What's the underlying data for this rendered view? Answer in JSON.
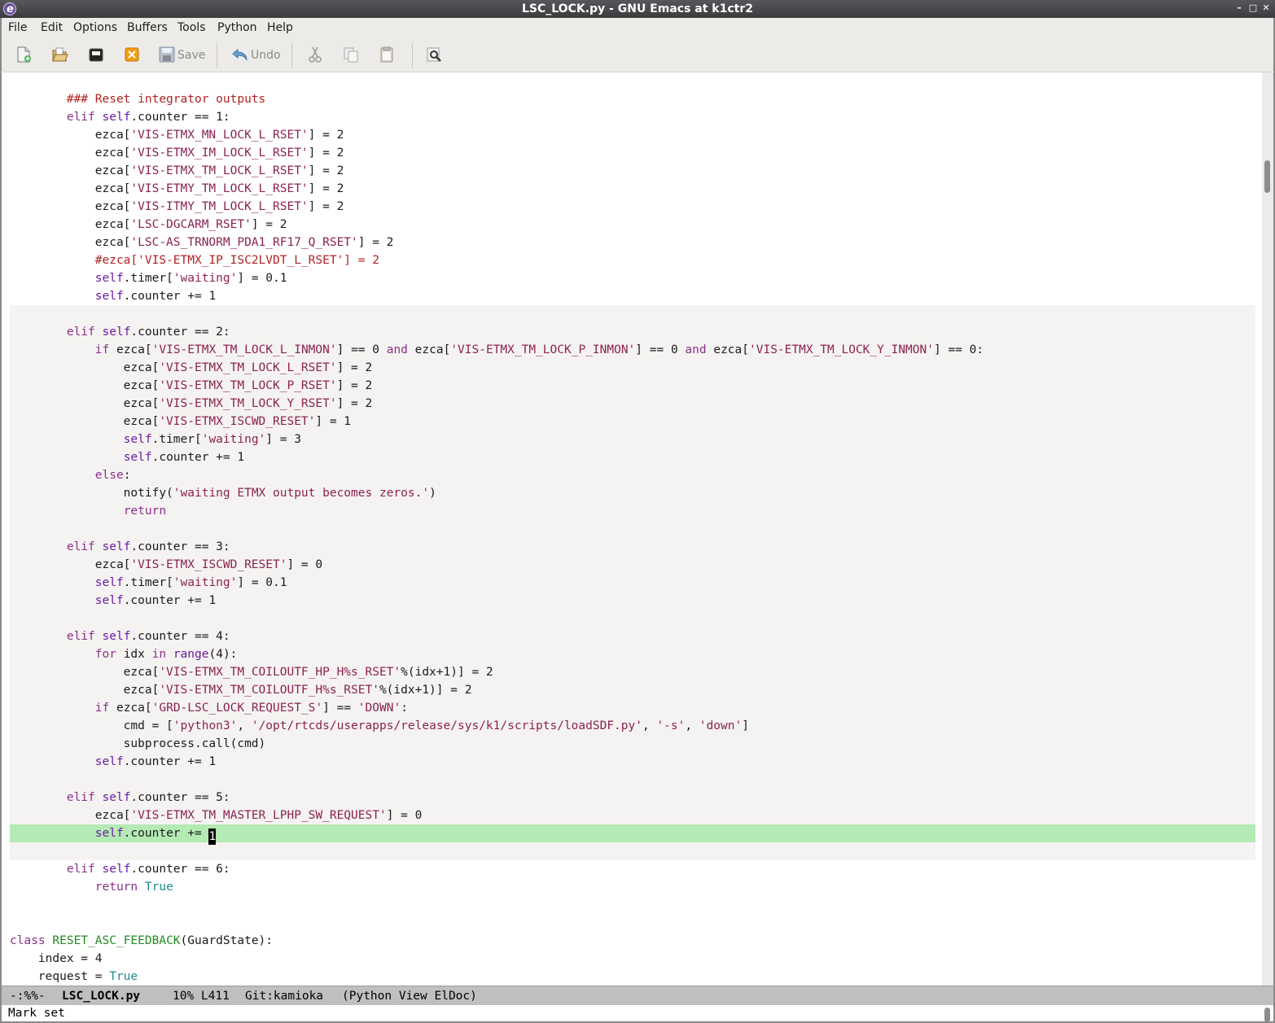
{
  "window": {
    "title": "LSC_LOCK.py - GNU Emacs at k1ctr2"
  },
  "menu": [
    "File",
    "Edit",
    "Options",
    "Buffers",
    "Tools",
    "Python",
    "Help"
  ],
  "toolbar": {
    "save_label": "Save",
    "undo_label": "Undo",
    "icons": [
      "new-file-icon",
      "open-file-icon",
      "dired-icon",
      "close-buffer-icon",
      "save-icon",
      "undo-icon",
      "cut-icon",
      "copy-icon",
      "paste-icon",
      "search-icon"
    ]
  },
  "code": {
    "lines": [
      "",
      [
        [
          "",
          "        "
        ],
        [
          "cm",
          "### Reset integrator outputs"
        ]
      ],
      [
        [
          "",
          "        "
        ],
        [
          "kw",
          "elif"
        ],
        [
          "",
          " "
        ],
        [
          "bi",
          "self"
        ],
        [
          "",
          ".counter == 1:"
        ]
      ],
      [
        [
          "",
          "            ezca["
        ],
        [
          "st",
          "'VIS-ETMX_MN_LOCK_L_RSET'"
        ],
        [
          "",
          "] = 2"
        ]
      ],
      [
        [
          "",
          "            ezca["
        ],
        [
          "st",
          "'VIS-ETMX_IM_LOCK_L_RSET'"
        ],
        [
          "",
          "] = 2"
        ]
      ],
      [
        [
          "",
          "            ezca["
        ],
        [
          "st",
          "'VIS-ETMX_TM_LOCK_L_RSET'"
        ],
        [
          "",
          "] = 2"
        ]
      ],
      [
        [
          "",
          "            ezca["
        ],
        [
          "st",
          "'VIS-ETMY_TM_LOCK_L_RSET'"
        ],
        [
          "",
          "] = 2"
        ]
      ],
      [
        [
          "",
          "            ezca["
        ],
        [
          "st",
          "'VIS-ITMY_TM_LOCK_L_RSET'"
        ],
        [
          "",
          "] = 2"
        ]
      ],
      [
        [
          "",
          "            ezca["
        ],
        [
          "st",
          "'LSC-DGCARM_RSET'"
        ],
        [
          "",
          "] = 2"
        ]
      ],
      [
        [
          "",
          "            ezca["
        ],
        [
          "st",
          "'LSC-AS_TRNORM_PDA1_RF17_Q_RSET'"
        ],
        [
          "",
          "] = 2"
        ]
      ],
      [
        [
          "",
          "            "
        ],
        [
          "cm",
          "#ezca['VIS-ETMX_IP_ISC2LVDT_L_RSET'] = 2"
        ]
      ],
      [
        [
          "",
          "            "
        ],
        [
          "bi",
          "self"
        ],
        [
          "",
          ".timer["
        ],
        [
          "st",
          "'waiting'"
        ],
        [
          "",
          "] = 0.1"
        ]
      ],
      [
        [
          "",
          "            "
        ],
        [
          "bi",
          "self"
        ],
        [
          "",
          ".counter += 1"
        ]
      ],
      "",
      [
        [
          "",
          "        "
        ],
        [
          "kw",
          "elif"
        ],
        [
          "",
          " "
        ],
        [
          "bi",
          "self"
        ],
        [
          "",
          ".counter == 2:"
        ]
      ],
      [
        [
          "",
          "            "
        ],
        [
          "kw",
          "if"
        ],
        [
          "",
          " ezca["
        ],
        [
          "st",
          "'VIS-ETMX_TM_LOCK_L_INMON'"
        ],
        [
          "",
          "] == 0 "
        ],
        [
          "kw",
          "and"
        ],
        [
          "",
          " ezca["
        ],
        [
          "st",
          "'VIS-ETMX_TM_LOCK_P_INMON'"
        ],
        [
          "",
          "] == 0 "
        ],
        [
          "kw",
          "and"
        ],
        [
          "",
          " ezca["
        ],
        [
          "st",
          "'VIS-ETMX_TM_LOCK_Y_INMON'"
        ],
        [
          "",
          "] == 0:"
        ]
      ],
      [
        [
          "",
          "                ezca["
        ],
        [
          "st",
          "'VIS-ETMX_TM_LOCK_L_RSET'"
        ],
        [
          "",
          "] = 2"
        ]
      ],
      [
        [
          "",
          "                ezca["
        ],
        [
          "st",
          "'VIS-ETMX_TM_LOCK_P_RSET'"
        ],
        [
          "",
          "] = 2"
        ]
      ],
      [
        [
          "",
          "                ezca["
        ],
        [
          "st",
          "'VIS-ETMX_TM_LOCK_Y_RSET'"
        ],
        [
          "",
          "] = 2"
        ]
      ],
      [
        [
          "",
          "                ezca["
        ],
        [
          "st",
          "'VIS-ETMX_ISCWD_RESET'"
        ],
        [
          "",
          "] = 1"
        ]
      ],
      [
        [
          "",
          "                "
        ],
        [
          "bi",
          "self"
        ],
        [
          "",
          ".timer["
        ],
        [
          "st",
          "'waiting'"
        ],
        [
          "",
          "] = 3"
        ]
      ],
      [
        [
          "",
          "                "
        ],
        [
          "bi",
          "self"
        ],
        [
          "",
          ".counter += 1"
        ]
      ],
      [
        [
          "",
          "            "
        ],
        [
          "kw",
          "else"
        ],
        [
          "",
          ":"
        ]
      ],
      [
        [
          "",
          "                notify("
        ],
        [
          "st",
          "'waiting ETMX output becomes zeros.'"
        ],
        [
          "",
          ")"
        ]
      ],
      [
        [
          "",
          "                "
        ],
        [
          "kw",
          "return"
        ]
      ],
      "",
      [
        [
          "",
          "        "
        ],
        [
          "kw",
          "elif"
        ],
        [
          "",
          " "
        ],
        [
          "bi",
          "self"
        ],
        [
          "",
          ".counter == 3:"
        ]
      ],
      [
        [
          "",
          "            ezca["
        ],
        [
          "st",
          "'VIS-ETMX_ISCWD_RESET'"
        ],
        [
          "",
          "] = 0"
        ]
      ],
      [
        [
          "",
          "            "
        ],
        [
          "bi",
          "self"
        ],
        [
          "",
          ".timer["
        ],
        [
          "st",
          "'waiting'"
        ],
        [
          "",
          "] = 0.1"
        ]
      ],
      [
        [
          "",
          "            "
        ],
        [
          "bi",
          "self"
        ],
        [
          "",
          ".counter += 1"
        ]
      ],
      "",
      [
        [
          "",
          "        "
        ],
        [
          "kw",
          "elif"
        ],
        [
          "",
          " "
        ],
        [
          "bi",
          "self"
        ],
        [
          "",
          ".counter == 4:"
        ]
      ],
      [
        [
          "",
          "            "
        ],
        [
          "kw",
          "for"
        ],
        [
          "",
          " idx "
        ],
        [
          "kw",
          "in"
        ],
        [
          "",
          " "
        ],
        [
          "bi",
          "range"
        ],
        [
          "",
          "(4):"
        ]
      ],
      [
        [
          "",
          "                ezca["
        ],
        [
          "st",
          "'VIS-ETMX_TM_COILOUTF_HP_H%s_RSET'"
        ],
        [
          "",
          "%(idx+1)] = 2"
        ]
      ],
      [
        [
          "",
          "                ezca["
        ],
        [
          "st",
          "'VIS-ETMX_TM_COILOUTF_H%s_RSET'"
        ],
        [
          "",
          "%(idx+1)] = 2"
        ]
      ],
      [
        [
          "",
          "            "
        ],
        [
          "kw",
          "if"
        ],
        [
          "",
          " ezca["
        ],
        [
          "st",
          "'GRD-LSC_LOCK_REQUEST_S'"
        ],
        [
          "",
          "] == "
        ],
        [
          "st",
          "'DOWN'"
        ],
        [
          "",
          ":"
        ]
      ],
      [
        [
          "",
          "                cmd = ["
        ],
        [
          "st",
          "'python3'"
        ],
        [
          "",
          ", "
        ],
        [
          "st",
          "'/opt/rtcds/userapps/release/sys/k1/scripts/loadSDF.py'"
        ],
        [
          "",
          ", "
        ],
        [
          "st",
          "'-s'"
        ],
        [
          "",
          ", "
        ],
        [
          "st",
          "'down'"
        ],
        [
          "",
          "]"
        ]
      ],
      [
        [
          "",
          "                subprocess.call(cmd)"
        ]
      ],
      [
        [
          "",
          "            "
        ],
        [
          "bi",
          "self"
        ],
        [
          "",
          ".counter += 1"
        ]
      ],
      "",
      [
        [
          "",
          "        "
        ],
        [
          "kw",
          "elif"
        ],
        [
          "",
          " "
        ],
        [
          "bi",
          "self"
        ],
        [
          "",
          ".counter == 5:"
        ]
      ],
      [
        [
          "",
          "            ezca["
        ],
        [
          "st",
          "'VIS-ETMX_TM_MASTER_LPHP_SW_REQUEST'"
        ],
        [
          "",
          "] = 0"
        ]
      ],
      [
        [
          "",
          "            "
        ],
        [
          "bi",
          "self"
        ],
        [
          "",
          ".counter += "
        ],
        [
          "cur",
          "1"
        ]
      ],
      "",
      [
        [
          "",
          "        "
        ],
        [
          "kw",
          "elif"
        ],
        [
          "",
          " "
        ],
        [
          "bi",
          "self"
        ],
        [
          "",
          ".counter == 6:"
        ]
      ],
      [
        [
          "",
          "            "
        ],
        [
          "kw",
          "return"
        ],
        [
          "",
          " "
        ],
        [
          "ct",
          "True"
        ]
      ],
      "",
      "",
      [
        [
          "kw",
          "class"
        ],
        [
          "",
          " "
        ],
        [
          "ty",
          "RESET_ASC_FEEDBACK"
        ],
        [
          "",
          "(GuardState):"
        ]
      ],
      [
        [
          "",
          "    index = 4"
        ]
      ],
      [
        [
          "",
          "    request = "
        ],
        [
          "ct",
          "True"
        ]
      ]
    ],
    "highlight_line": 42,
    "white_bands": [
      [
        0,
        13
      ],
      [
        44,
        51
      ]
    ]
  },
  "modeline": {
    "status": "-:%%-",
    "buffer": "LSC_LOCK.py",
    "position": "10% L411",
    "vcs": "Git:kamioka",
    "modes": "(Python View ElDoc)"
  },
  "minibuffer": {
    "message": "Mark set"
  }
}
